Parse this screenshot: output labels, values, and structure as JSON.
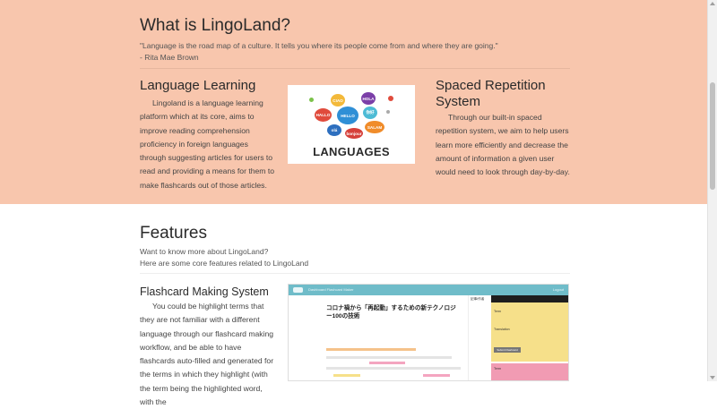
{
  "about": {
    "title": "What is LingoLand?",
    "quote": "\"Language is the road map of a culture. It tells you where its people come from and where they are going.\"",
    "author": "- Rita Mae Brown",
    "language_learning": {
      "heading": "Language Learning",
      "text": "Lingoland is a language learning platform which at its core, aims to improve reading comprehension proficiency in foreign languages through suggesting articles for users to read and providing a means for them to make flashcards out of those articles."
    },
    "spaced_repetition": {
      "heading": "Spaced Repetition System",
      "text": "Through our built-in spaced repetition system, we aim to help users learn more efficiently and decrease the amount of information a given user would need to look through day-by-day."
    },
    "image": {
      "caption": "LANGUAGES",
      "bubbles": [
        "CIAO",
        "HOLA",
        "HALLO",
        "HELLO",
        "你好",
        "olá",
        "SALAM",
        "bonjour"
      ]
    }
  },
  "features": {
    "title": "Features",
    "subtitle_1": "Want to know more about LingoLand?",
    "subtitle_2": "Here are some core features related to LingoLand",
    "flashcard": {
      "heading": "Flashcard Making System",
      "text": "You could be highlight terms that they are not familiar with a different language through our flashcard making workflow, and be able to have flashcards auto-filled and generated for the terms in which they highlight (with the term being the highlighted word, with the"
    },
    "screenshot": {
      "nav": "Dashboard   Flashcard Maker",
      "logout": "Logout",
      "article_title": "コロナ禍から「再起動」するための新テクノロジー100の技術",
      "side_label": "記事/作者",
      "term_label": "Term",
      "translation_label": "Translation",
      "button": "Submit Flashcard"
    }
  },
  "colors": {
    "about_bg": "#f8c6ad",
    "shot_bar": "#6fbcc9",
    "flashcard_yellow": "#f6e08a",
    "flashcard_pink": "#f19bb3"
  }
}
